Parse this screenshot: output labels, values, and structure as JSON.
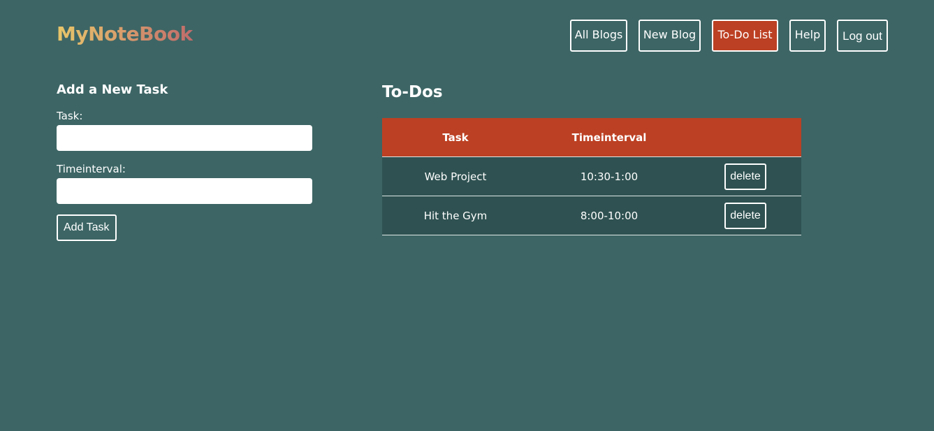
{
  "app": {
    "logo": "MyNoteBook"
  },
  "nav": {
    "all_blogs": "All Blogs",
    "new_blog": "New Blog",
    "todo_list": "To-Do List",
    "help": "Help",
    "logout": "Log out",
    "active": "To-Do List"
  },
  "form": {
    "title": "Add a New Task",
    "task_label": "Task:",
    "task_value": "",
    "timeinterval_label": "Timeinterval:",
    "timeinterval_value": "",
    "submit_label": "Add Task"
  },
  "todos": {
    "title": "To-Dos",
    "columns": [
      "Task",
      "Timeinterval",
      ""
    ],
    "rows": [
      {
        "task": "Web Project",
        "timeinterval": "10:30-1:00",
        "action": "delete"
      },
      {
        "task": "Hit the Gym",
        "timeinterval": "8:00-10:00",
        "action": "delete"
      }
    ]
  },
  "colors": {
    "background": "#3d6565",
    "accent": "#bc4023",
    "row_background": "#2f5151",
    "text": "#ffffff"
  }
}
